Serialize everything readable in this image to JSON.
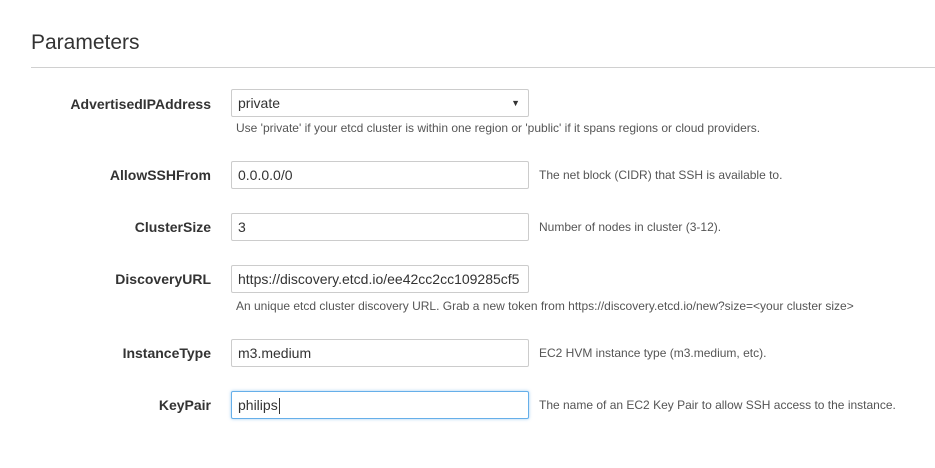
{
  "section": {
    "title": "Parameters"
  },
  "params": [
    {
      "label": "AdvertisedIPAddress",
      "value": "private",
      "help": "Use 'private' if your etcd cluster is within one region or 'public' if it spans regions or cloud providers."
    },
    {
      "label": "AllowSSHFrom",
      "value": "0.0.0.0/0",
      "help": "The net block (CIDR) that SSH is available to."
    },
    {
      "label": "ClusterSize",
      "value": "3",
      "help": "Number of nodes in cluster (3-12)."
    },
    {
      "label": "DiscoveryURL",
      "value": "https://discovery.etcd.io/ee42cc2cc109285cf5",
      "help": "An unique etcd cluster discovery URL. Grab a new token from https://discovery.etcd.io/new?size=<your cluster size>"
    },
    {
      "label": "InstanceType",
      "value": "m3.medium",
      "help": "EC2 HVM instance type (m3.medium, etc)."
    },
    {
      "label": "KeyPair",
      "value": "philips",
      "help": "The name of an EC2 Key Pair to allow SSH access to the instance."
    }
  ],
  "icons": {
    "dropdown": "chevron-down-icon"
  }
}
